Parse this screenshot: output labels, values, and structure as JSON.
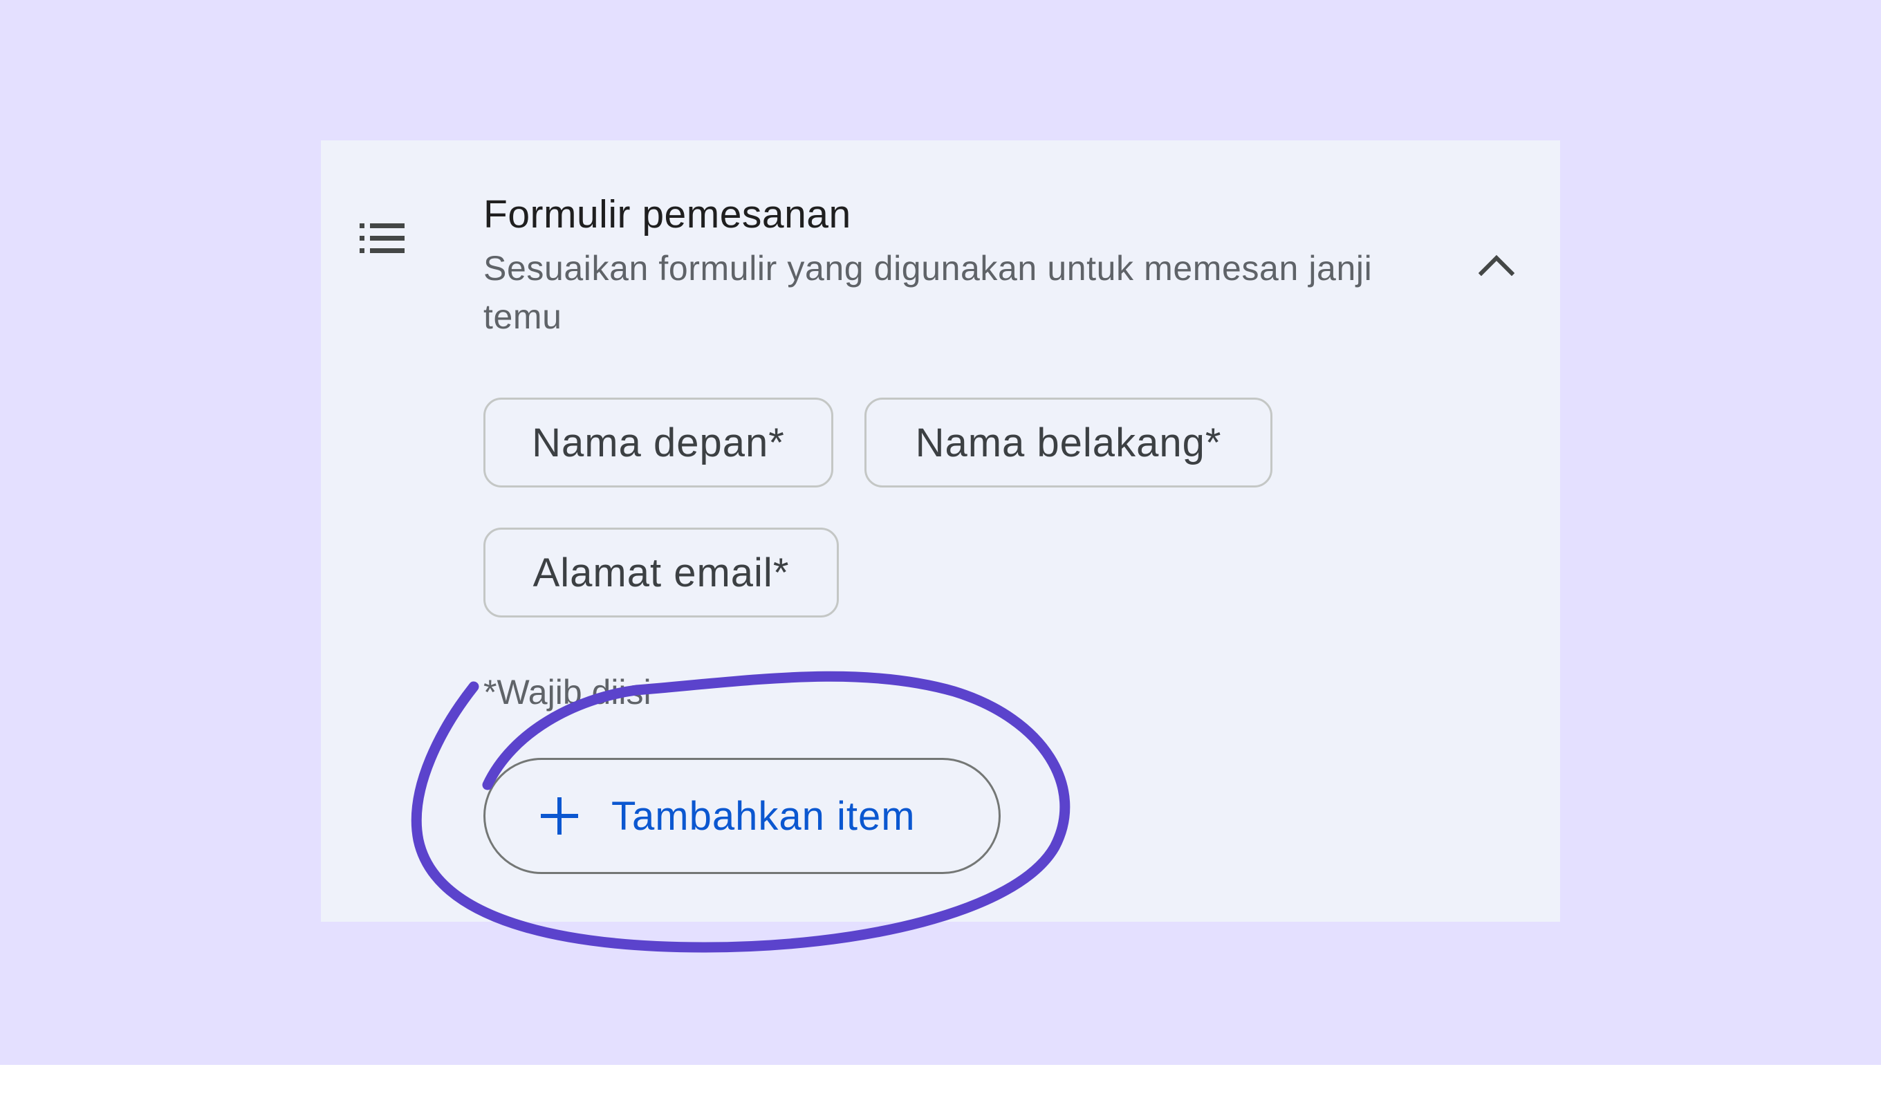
{
  "colors": {
    "backdrop": "#e4e0ff",
    "panel": "#eff2fa",
    "accent_blue": "#0b57d0",
    "annotation_purple": "#5b43cc"
  },
  "section": {
    "icon": "list-icon",
    "title": "Formulir pemesanan",
    "subtitle": "Sesuaikan formulir yang digunakan untuk memesan janji temu",
    "collapse_icon": "chevron-up-icon"
  },
  "fields": [
    {
      "label": "Nama depan*"
    },
    {
      "label": "Nama belakang*"
    },
    {
      "label": "Alamat email*"
    }
  ],
  "required_note": "*Wajib diisi",
  "add_button": {
    "icon": "plus-icon",
    "label": "Tambahkan item"
  }
}
